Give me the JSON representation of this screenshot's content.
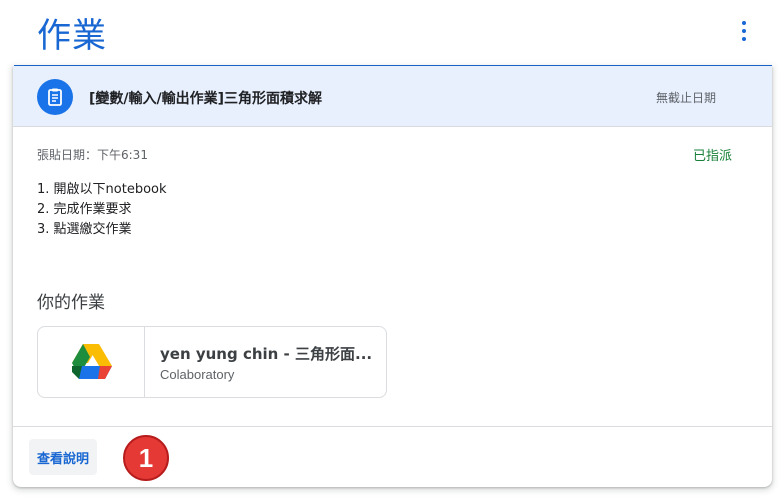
{
  "page": {
    "title": "作業"
  },
  "assignment": {
    "title": "[變數/輸入/輸出作業]三角形面積求解",
    "due": "無截止日期",
    "posted": "張貼日期：下午6:31",
    "status": "已指派",
    "instructions": [
      "1. 開啟以下notebook",
      "2. 完成作業要求",
      "3. 點選繳交作業"
    ]
  },
  "your_work": {
    "heading": "你的作業",
    "attachment": {
      "title": "yen yung chin - 三角形面...",
      "subtitle": "Colaboratory",
      "icon": "google-drive-icon"
    }
  },
  "footer": {
    "view_instructions_label": "查看說明",
    "step_badge": "1"
  },
  "colors": {
    "accent": "#1967d2",
    "header_bg": "#e8f0fe",
    "status": "#188038",
    "badge": "#e53935"
  }
}
